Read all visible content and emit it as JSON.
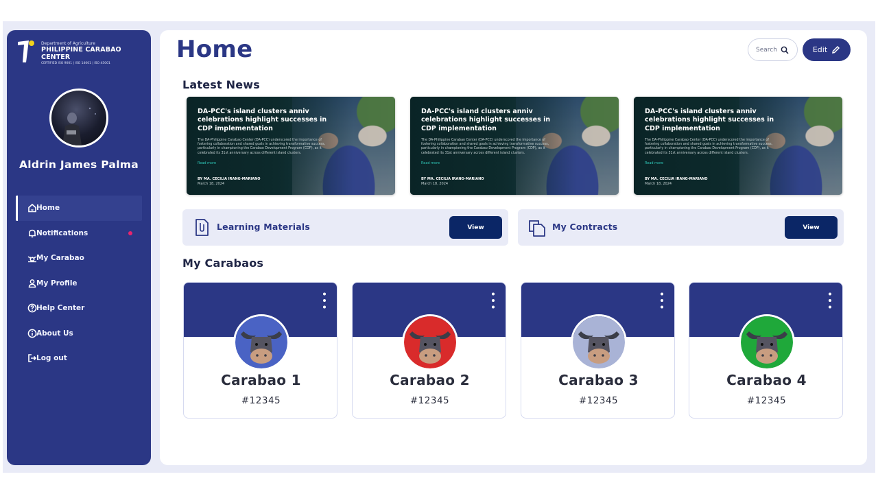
{
  "app": {
    "logo": {
      "dept": "Department of Agriculture",
      "name": "PHILIPPINE CARABAO CENTER",
      "cert": "CERTIFIED ISO 9001 | ISO 14001 | ISO 45001"
    },
    "user_name": "Aldrin James Palma"
  },
  "sidebar": {
    "items": [
      {
        "label": "Home",
        "icon": "home-icon",
        "active": true
      },
      {
        "label": "Notifications",
        "icon": "bell-icon",
        "badge": true
      },
      {
        "label": "My Carabao",
        "icon": "carabao-icon"
      },
      {
        "label": "My Profile",
        "icon": "user-icon"
      },
      {
        "label": "Help Center",
        "icon": "help-icon"
      },
      {
        "label": "About Us",
        "icon": "info-icon"
      },
      {
        "label": "Log out",
        "icon": "logout-icon"
      }
    ]
  },
  "header": {
    "title": "Home",
    "search_label": "Search",
    "edit_label": "Edit"
  },
  "news": {
    "title": "Latest News",
    "items": [
      {
        "headline": "DA-PCC's island clusters anniv celebrations highlight successes in CDP implementation",
        "body": "The DA-Philippine Carabao Center (DA-PCC) underscored the importance of fostering collaboration and shared goals in achieving transformative success, particularly in championing the Carabao Development Program (CDP), as it celebrated its 31st anniversary across different island clusters.",
        "read_more": "Read more",
        "byline": "BY  MA. CECILIA IRANG-MARIANO",
        "date": "March 18, 2024"
      },
      {
        "headline": "DA-PCC's island clusters anniv celebrations highlight successes in CDP implementation",
        "body": "The DA-Philippine Carabao Center (DA-PCC) underscored the importance of fostering collaboration and shared goals in achieving transformative success, particularly in championing the Carabao Development Program (CDP), as it celebrated its 31st anniversary across different island clusters.",
        "read_more": "Read more",
        "byline": "BY  MA. CECILIA IRANG-MARIANO",
        "date": "March 18, 2024"
      },
      {
        "headline": "DA-PCC's island clusters anniv celebrations highlight successes in CDP implementation",
        "body": "The DA-Philippine Carabao Center (DA-PCC) underscored the importance of fostering collaboration and shared goals in achieving transformative success, particularly in championing the Carabao Development Program (CDP), as it celebrated its 31st anniversary across different island clusters.",
        "read_more": "Read more",
        "byline": "BY  MA. CECILIA IRANG-MARIANO",
        "date": "March 18, 2024"
      }
    ]
  },
  "quick_links": [
    {
      "label": "Learning Materials",
      "button": "View",
      "icon": "paperclip-document-icon"
    },
    {
      "label": "My Contracts",
      "button": "View",
      "icon": "copy-documents-icon"
    }
  ],
  "carabaos": {
    "title": "My Carabaos",
    "items": [
      {
        "name": "Carabao 1",
        "id": "#12345",
        "color": "#4a63c4"
      },
      {
        "name": "Carabao 2",
        "id": "#12345",
        "color": "#d92b2b"
      },
      {
        "name": "Carabao 3",
        "id": "#12345",
        "color": "#a9b3d6"
      },
      {
        "name": "Carabao 4",
        "id": "#12345",
        "color": "#1fa83a"
      }
    ]
  },
  "colors": {
    "primary": "#2b3785",
    "button_dark": "#0b2666",
    "accent_dot": "#e8246e",
    "panel": "#e9ebf7"
  }
}
